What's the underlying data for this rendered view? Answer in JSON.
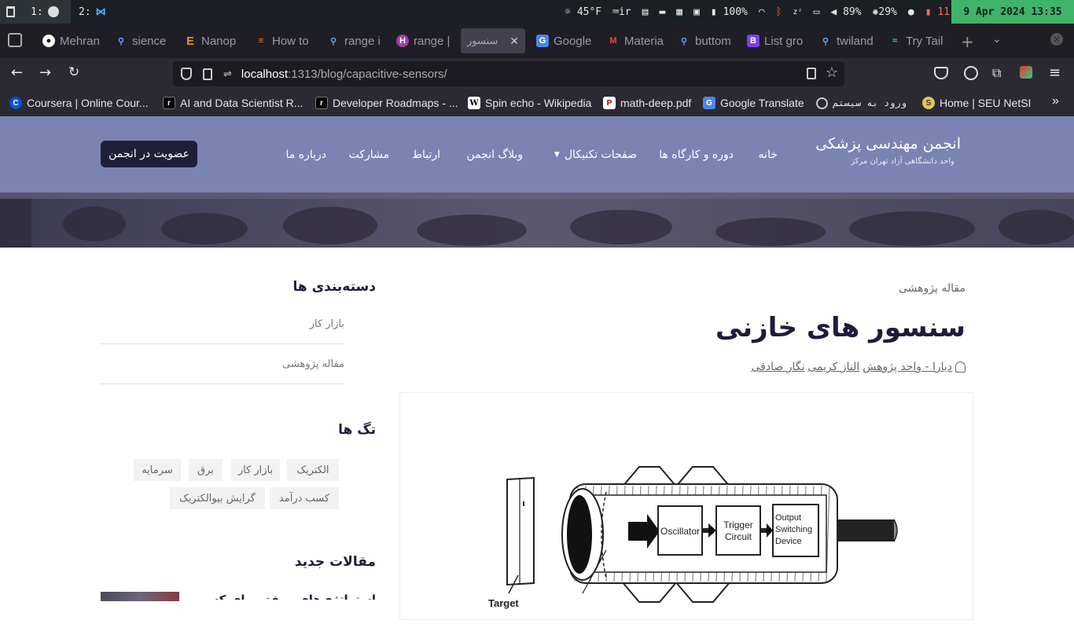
{
  "statusbar": {
    "ws1_label": "1:",
    "ws2_label": "2:",
    "weather": "45°F",
    "keyboard": "ir",
    "battery": "100%",
    "volume": "89%",
    "brightness": "29%",
    "notifications": "11",
    "datetime": "9 Apr 2024 13:35"
  },
  "tabs": [
    {
      "title": "Mehran",
      "icon": "github-icon",
      "color": "#ffffff"
    },
    {
      "title": "sience",
      "icon": "search-icon",
      "color": "#5aa0ff"
    },
    {
      "title": "Nanop",
      "icon": "e-icon",
      "color": "#e8912c"
    },
    {
      "title": "How to",
      "icon": "stackoverflow-icon",
      "color": "#f48024"
    },
    {
      "title": "range i",
      "icon": "search-icon",
      "color": "#5aa0ff"
    },
    {
      "title": "range |",
      "icon": "h-icon",
      "color": "#a23ba6"
    },
    {
      "title": "سنسور",
      "icon": "",
      "color": "#dddddd"
    },
    {
      "title": "Google",
      "icon": "translate-icon",
      "color": "#4a86e8"
    },
    {
      "title": "Materia",
      "icon": "m-icon",
      "color": "#e04c3c"
    },
    {
      "title": "buttom",
      "icon": "search-icon",
      "color": "#5aa0ff"
    },
    {
      "title": "List gro",
      "icon": "b-icon",
      "color": "#7a3ff2"
    },
    {
      "title": "twiland",
      "icon": "search-icon",
      "color": "#5aa0ff"
    },
    {
      "title": "Try Tail",
      "icon": "tailwind-icon",
      "color": "#38bdf8"
    }
  ],
  "url": {
    "host": "localhost",
    "rest": ":1313/blog/capacitive-sensors/"
  },
  "bookmarks": [
    {
      "title": "Coursera | Online Cour...",
      "icon": "C"
    },
    {
      "title": "AI and Data Scientist R...",
      "icon": "r"
    },
    {
      "title": "Developer Roadmaps - ...",
      "icon": "r"
    },
    {
      "title": "Spin echo - Wikipedia",
      "icon": "W"
    },
    {
      "title": "math-deep.pdf",
      "icon": "P"
    },
    {
      "title": "Google Translate",
      "icon": "G"
    },
    {
      "title": "ورود به سیستم",
      "icon": "globe"
    },
    {
      "title": "Home | SEU NetSI",
      "icon": "S"
    }
  ],
  "site": {
    "name": "انجمن مهندسی پزشکی",
    "subname": "واحد دانشگاهی آزاد تهران مرکز",
    "nav": [
      "خانه",
      "دوره و کارگاه ها",
      "صفحات تکنیکال",
      "وبلاگ انجمن",
      "ارتباط",
      "مشارکت",
      "درباره ما"
    ],
    "join_button": "عضویت در انجمن"
  },
  "article": {
    "category": "مقاله پژوهشی",
    "title": "سنسور های خازنی",
    "author1": "دیارا - واحد پژوهش",
    "author2": "الناز کریمی",
    "author3": "نگار صادقی",
    "diagram": {
      "block1": "Oscillator",
      "block2a": "Trigger",
      "block2b": "Circuit",
      "block3a": "Output",
      "block3b": "Switching",
      "block3c": "Device",
      "target_label": "Target"
    }
  },
  "sidebar": {
    "categories_title": "دسته‌بندی ها",
    "categories": [
      "بازار کار",
      "مقاله پژوهشی"
    ],
    "tags_title": "تگ ها",
    "tags": [
      "الکتریک",
      "بازار کار",
      "برق",
      "سرمایه",
      "کسب درآمد",
      "گرایش بیوالکتریک"
    ],
    "recent_title": "مقالات جدید",
    "recent_first": "استراتژی‌های موفق برای کسب"
  }
}
